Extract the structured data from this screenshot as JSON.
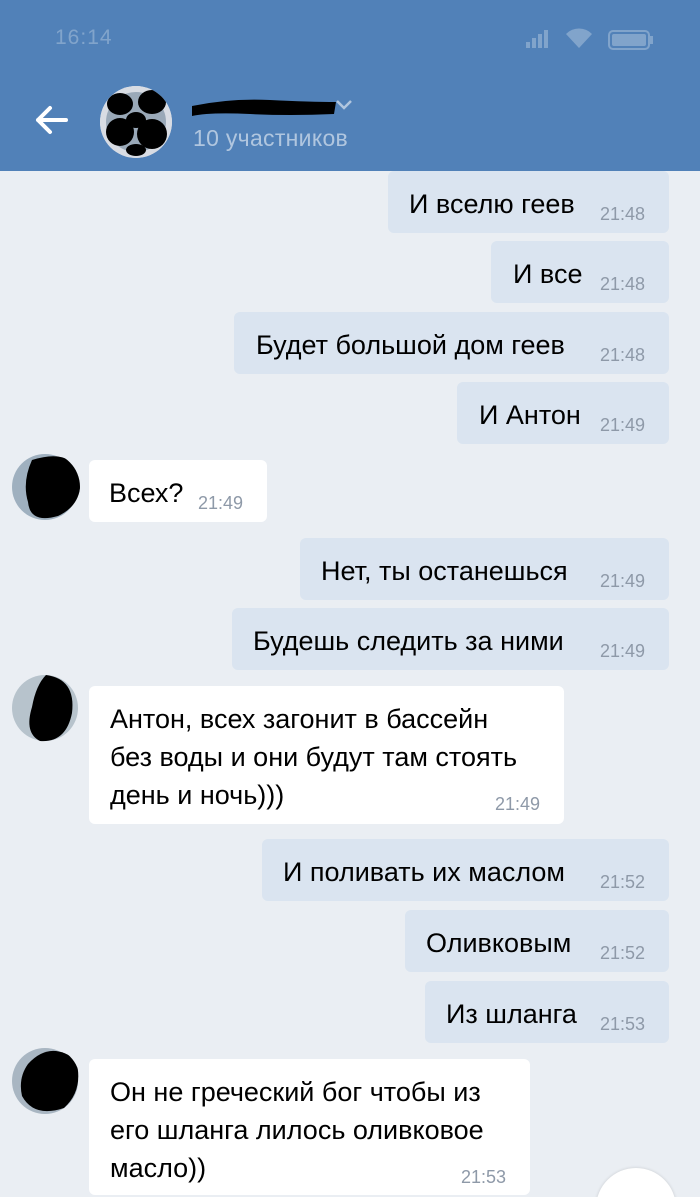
{
  "status_bar": {
    "time": "16:14"
  },
  "header": {
    "participants": "10 участников",
    "back_icon": "arrow-left-icon",
    "chevron_icon": "chevron-down-icon",
    "background_color": "#5181b8"
  },
  "messages": [
    {
      "direction": "out",
      "text": "И вселю геев",
      "time": "21:48"
    },
    {
      "direction": "out",
      "text": "И все",
      "time": "21:48"
    },
    {
      "direction": "out",
      "text": "Будет большой дом геев",
      "time": "21:48"
    },
    {
      "direction": "out",
      "text": "И Антон",
      "time": "21:49"
    },
    {
      "direction": "in",
      "text": "Всех?",
      "time": "21:49"
    },
    {
      "direction": "out",
      "text": "Нет, ты останешься",
      "time": "21:49"
    },
    {
      "direction": "out",
      "text": "Будешь следить за ними",
      "time": "21:49"
    },
    {
      "direction": "in",
      "lines": [
        "Антон, всех загонит в бассейн",
        "без воды и они будут там стоять",
        "день и ночь)))"
      ],
      "time": "21:49"
    },
    {
      "direction": "out",
      "text": "И поливать их маслом",
      "time": "21:52"
    },
    {
      "direction": "out",
      "text": "Оливковым",
      "time": "21:52"
    },
    {
      "direction": "out",
      "text": "Из шланга",
      "time": "21:53"
    },
    {
      "direction": "in",
      "lines": [
        "Он не греческий бог чтобы из",
        "его шланга лилось оливковое",
        "масло))"
      ],
      "time": "21:53"
    }
  ],
  "colors": {
    "outgoing_bubble": "#dae4f0",
    "incoming_bubble": "#ffffff",
    "chat_background": "#eaeef3",
    "timestamp": "#8e99a8"
  }
}
